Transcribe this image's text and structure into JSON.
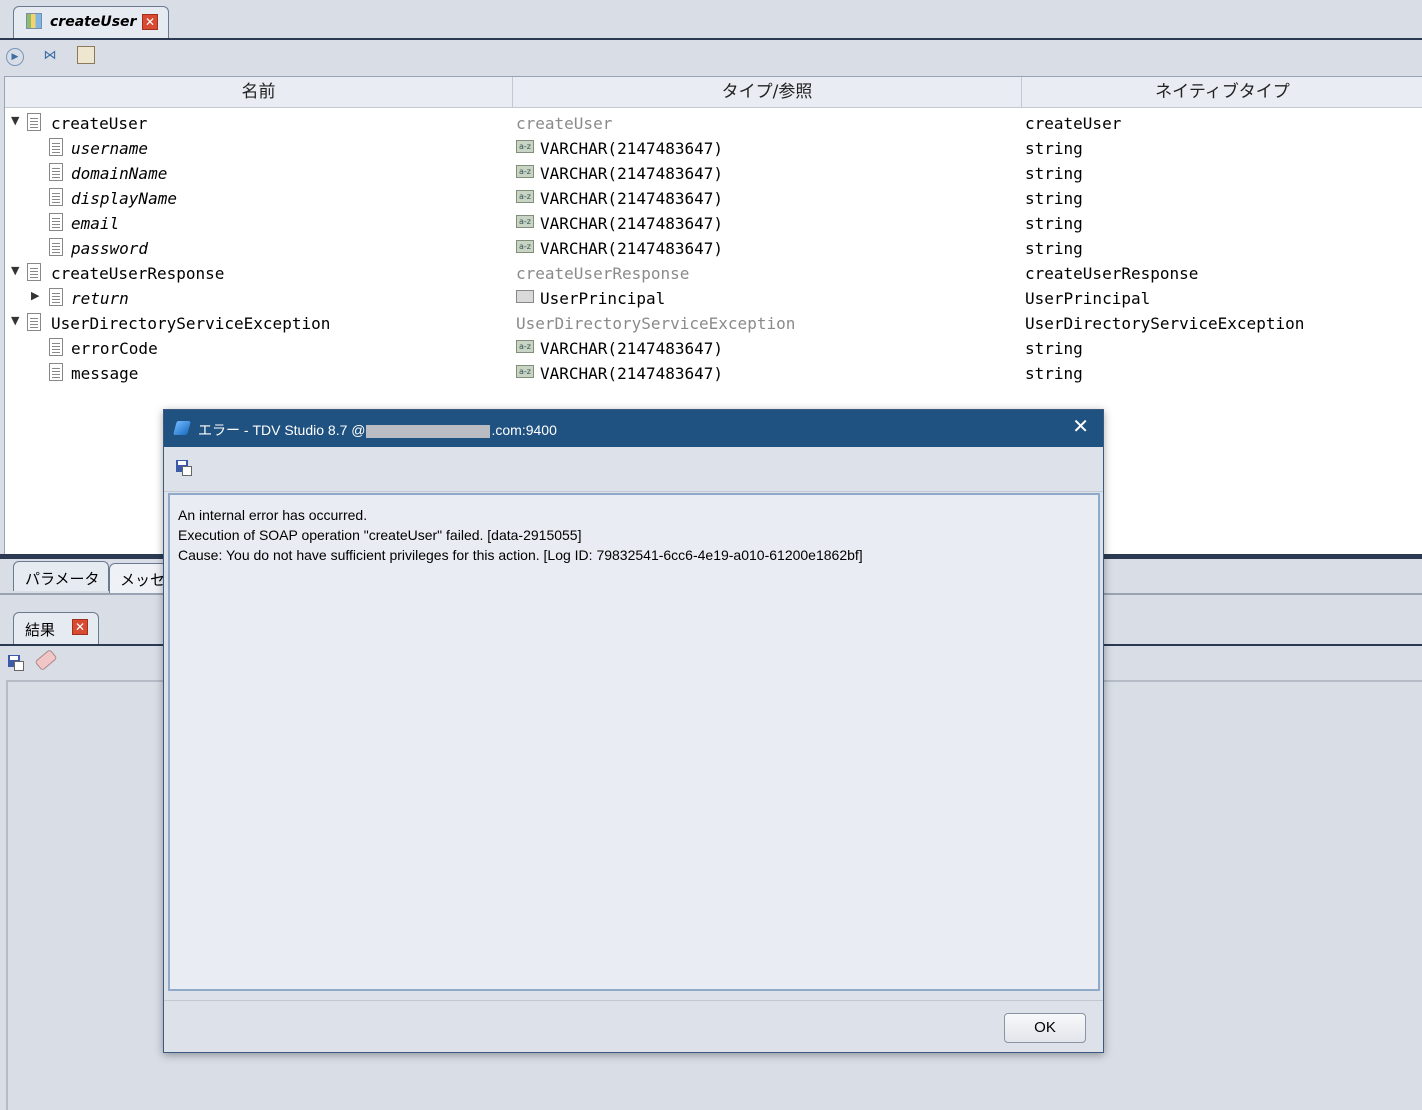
{
  "top_tab": {
    "label": "createUser"
  },
  "table": {
    "headers": [
      "名前",
      "タイプ/参照",
      "ネイティブタイプ"
    ],
    "rows": [
      {
        "name": "createUser",
        "type": "createUser",
        "native": "createUser"
      },
      {
        "name": "username",
        "type": "VARCHAR(2147483647)",
        "native": "string"
      },
      {
        "name": "domainName",
        "type": "VARCHAR(2147483647)",
        "native": "string"
      },
      {
        "name": "displayName",
        "type": "VARCHAR(2147483647)",
        "native": "string"
      },
      {
        "name": "email",
        "type": "VARCHAR(2147483647)",
        "native": "string"
      },
      {
        "name": "password",
        "type": "VARCHAR(2147483647)",
        "native": "string"
      },
      {
        "name": "createUserResponse",
        "type": "createUserResponse",
        "native": "createUserResponse"
      },
      {
        "name": "return",
        "type": "UserPrincipal",
        "native": "UserPrincipal"
      },
      {
        "name": "UserDirectoryServiceException",
        "type": "UserDirectoryServiceException",
        "native": "UserDirectoryServiceException"
      },
      {
        "name": "errorCode",
        "type": "VARCHAR(2147483647)",
        "native": "string"
      },
      {
        "name": "message",
        "type": "VARCHAR(2147483647)",
        "native": "string"
      }
    ],
    "type_icon_text": "a-z"
  },
  "lower_tabs": {
    "params": "パラメータ",
    "messages": "メッセ"
  },
  "results_tab": {
    "label": "結果"
  },
  "dialog": {
    "title_prefix": "エラー - TDV Studio 8.7 @",
    "title_suffix": ".com:9400",
    "lines": [
      "An internal error has occurred.",
      "Execution of SOAP operation \"createUser\" failed.  [data-2915055]",
      "Cause: You do not have sufficient privileges for this action. [Log ID: 79832541-6cc6-4e19-a010-61200e1862bf]"
    ],
    "ok_label": "OK",
    "close_glyph": "✕"
  },
  "glyphs": {
    "close_x": "✕",
    "expanded": "▼",
    "collapsed": "▶"
  }
}
